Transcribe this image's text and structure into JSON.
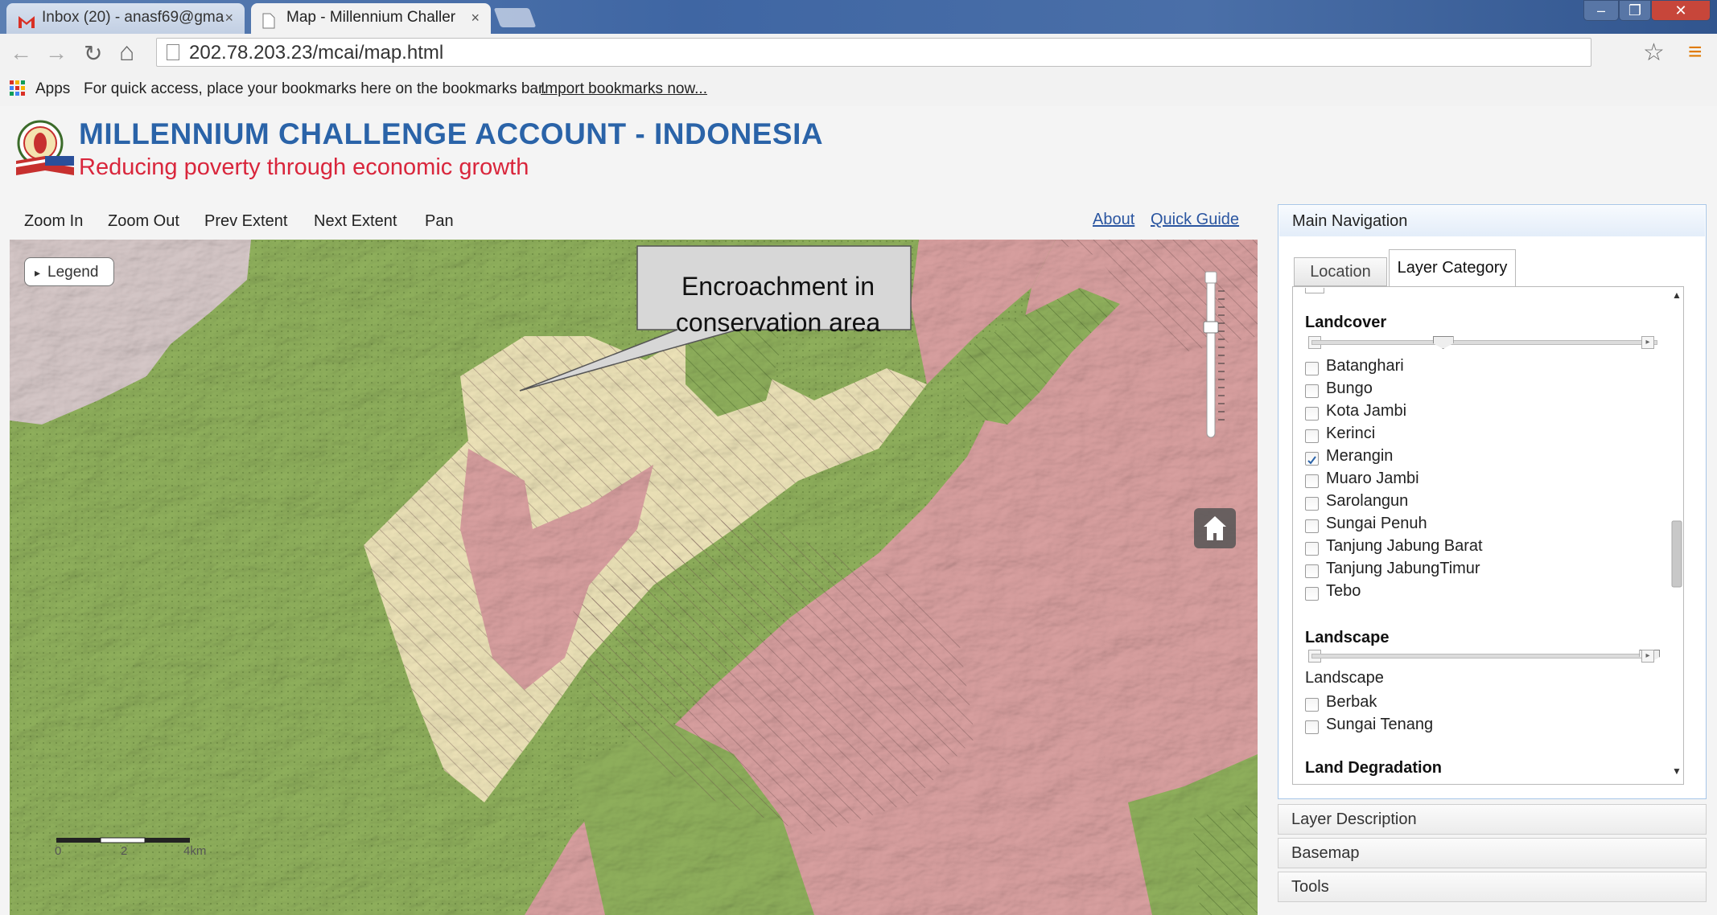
{
  "browser": {
    "tabs": [
      {
        "label": "Inbox (20) - anasf69@gma",
        "icon": "gmail-icon",
        "active": false
      },
      {
        "label": "Map - Millennium Challer",
        "icon": "page-icon",
        "active": true
      }
    ],
    "close_glyph": "×",
    "window_controls": {
      "minimize": "–",
      "restore": "❐",
      "close": "✕"
    },
    "nav": {
      "back": "←",
      "forward": "→",
      "reload": "↻",
      "home": "⌂"
    },
    "url": "202.78.203.23/mcai/map.html",
    "star": "☆",
    "menu": "≡",
    "bookmarks_bar": {
      "apps_label": "Apps",
      "message": "For quick access, place your bookmarks here on the bookmarks bar.",
      "import_link": "Import bookmarks now..."
    }
  },
  "site": {
    "title": "MILLENNIUM CHALLENGE ACCOUNT - INDONESIA",
    "subtitle": "Reducing poverty through economic growth",
    "title_color": "#2a63a8",
    "subtitle_color": "#d9263c"
  },
  "map_toolbar": {
    "tools": [
      "Zoom In",
      "Zoom Out",
      "Prev Extent",
      "Next Extent",
      "Pan"
    ],
    "links": [
      "About",
      "Quick Guide"
    ]
  },
  "map": {
    "legend_button": "Legend",
    "legend_arrow": "▸",
    "callout": [
      "Encroachment in",
      "conservation area"
    ],
    "scale": {
      "ticks": [
        "0",
        "2",
        "4km"
      ]
    },
    "home_glyph": "⌂",
    "colors": {
      "forest": "#8fb05c",
      "agriculture": "#d9a0a0",
      "shrub": "#ede3b8",
      "settlement": "#d6c8c8"
    }
  },
  "panel": {
    "header": "Main Navigation",
    "tabs": [
      {
        "label": "Location",
        "active": false
      },
      {
        "label": "Layer Category",
        "active": true
      }
    ],
    "sections": [
      {
        "title": "Landcover",
        "slider": {
          "value": 0.38
        },
        "items": [
          {
            "label": "Batanghari",
            "checked": false
          },
          {
            "label": "Bungo",
            "checked": false
          },
          {
            "label": "Kota Jambi",
            "checked": false
          },
          {
            "label": "Kerinci",
            "checked": false
          },
          {
            "label": "Merangin",
            "checked": true
          },
          {
            "label": "Muaro Jambi",
            "checked": false
          },
          {
            "label": "Sarolangun",
            "checked": false
          },
          {
            "label": "Sungai Penuh",
            "checked": false
          },
          {
            "label": "Tanjung Jabung Barat",
            "checked": false
          },
          {
            "label": "Tanjung JabungTimur",
            "checked": false
          },
          {
            "label": "Tebo",
            "checked": false
          }
        ]
      },
      {
        "title": "Landscape",
        "slider": {
          "value": 0.98
        },
        "group_label": "Landscape",
        "items": [
          {
            "label": "Berbak",
            "checked": false
          },
          {
            "label": "Sungai Tenang",
            "checked": false
          }
        ]
      },
      {
        "title": "Land Degradation"
      }
    ],
    "accordion": [
      "Layer Description",
      "Basemap",
      "Tools"
    ],
    "scroll_up": "▲",
    "scroll_down": "▼"
  }
}
